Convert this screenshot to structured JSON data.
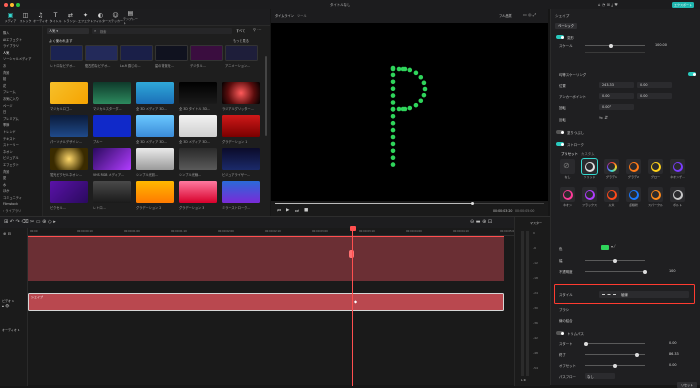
{
  "app": {
    "title": "タイトルなし"
  },
  "titlebar": {
    "export_label": "エクスポート"
  },
  "toolbar": {
    "items": [
      {
        "label": "メディア",
        "glyph": "▣"
      },
      {
        "label": "ストック",
        "glyph": "◫"
      },
      {
        "label": "オーディオ",
        "glyph": "♫"
      },
      {
        "label": "タイトル",
        "glyph": "T"
      },
      {
        "label": "トランジ..",
        "glyph": "⇄"
      },
      {
        "label": "エフェクト",
        "glyph": "✦"
      },
      {
        "label": "フィルター",
        "glyph": "◐"
      },
      {
        "label": "ステッカー",
        "glyph": "☺"
      },
      {
        "label": "テンプレート",
        "glyph": "▤"
      }
    ]
  },
  "sidebar": {
    "items": [
      "購入",
      "AIエフェクト",
      "ライブラリ",
      "人気",
      "ソーシャルメディア",
      "お",
      "背景",
      "桜",
      "花",
      "フレーム",
      "お気に入り",
      "ページ",
      "日",
      "プレミアム",
      "季節",
      "トレンド",
      "テキスト",
      "ストーリー",
      "ネオン",
      "ビジュアル",
      "エフェクト",
      "背景",
      "夏",
      "水",
      "ほか",
      "コミュニティ",
      "Filmstock"
    ],
    "footer": "‹ ライブラリ"
  },
  "media": {
    "tab_label": "人気",
    "search_placeholder": "検索",
    "filter_label": "すべて",
    "section_label": "よく使われます",
    "more_label": "もっと見る",
    "row1_labels": [
      "レトロなビデオ...",
      "復古的なビデオ...",
      "Lo-fi 感じの...",
      "星の背景を...",
      "デジタル...",
      "アニメーション..."
    ],
    "tile_labels": [
      "マジカルロゴ...",
      "マジカルスターダ...",
      "全 3D メディア 3D...",
      "全 3D タイトル 3D...",
      "ラジアルグリッター...",
      "パーソナルデザイン...",
      "ブルー",
      "全 3D メディア 3D...",
      "全 3D メディア 3D...",
      "グラデーション 1",
      "蛍光ピクセルネオン...",
      "VHS RGB メディア...",
      "シンプル光彩...",
      "シンプル光線...",
      "ビジュアライザー...",
      "ピクセル...",
      "レトロ...",
      "グラデーション 2",
      "グラデーション 3",
      "ミラーストローク..."
    ]
  },
  "viewer": {
    "mode_label": "タイムライン",
    "tool_label": "ツール",
    "quality_label": "フル品質",
    "timecode_current": "00:00:03:20",
    "timecode_total": "00:00:05:00",
    "canvas_letter": "P"
  },
  "right_panel": {
    "tab_label": "シェイプ",
    "subtab_label": "ベーシック",
    "sections": {
      "transform": "変形",
      "scale": "スケール",
      "scale_value": "100.00",
      "uniform_scaling": "均等スケーリング",
      "position": "位置",
      "position_x": "243.33",
      "position_y": "0.00",
      "anchor": "アンカーポイント",
      "anchor_x": "0.00",
      "anchor_y": "0.00",
      "rotate": "回転",
      "rotate_value": "0.00°",
      "flip": "反転",
      "fill": "塗りつぶし",
      "stroke": "ストローク",
      "preset_tab": "プリセット",
      "custom_tab": "カスタム",
      "preset_labels": [
        "なし",
        "ソリッド",
        "グラデ1",
        "グラデ2",
        "グロー",
        "ネオンゲ...",
        "ネオン",
        "フラックス",
        "火炎",
        "点線状",
        "スパークル",
        "ボルト"
      ],
      "color_label": "色",
      "width_label": "幅",
      "opacity_label": "不透明度",
      "opacity_value": "100",
      "style_label": "スタイル",
      "style_value": "破線",
      "taper_label": "ブラシ",
      "join_label": "線の結合",
      "trim_label": "トリムパス",
      "trim_start": "スタート",
      "trim_start_value": "0.00",
      "trim_end": "終了",
      "trim_end_value": "86.33",
      "trim_offset": "オフセット",
      "trim_offset_value": "0.00",
      "path_label": "パスフロー",
      "path_value": "なし",
      "reset_label": "リセット"
    }
  },
  "timeline": {
    "ruler_labels": [
      "00:00",
      "00:00:00:10",
      "00:00:01:00",
      "00:00:01:10",
      "00:00:02:00",
      "00:00:02:10",
      "00:00:03:00",
      "00:00:03:10",
      "00:00:04:00",
      "00:00:04:10",
      "00:00:05:00"
    ],
    "master_label": "マスター",
    "track_video_label": "ビデオ 1",
    "track_audio_label": "オーディオ 1",
    "clip_label": "シェイプ",
    "meter_labels": [
      "0",
      "-6",
      "-12",
      "-18",
      "-24",
      "-30",
      "-36",
      "-42",
      "-48",
      "-54"
    ],
    "meter_lr": "L   R"
  },
  "colors": {
    "accent": "#35d9d0",
    "playhead": "#ff4f4f",
    "clip": "#b9484f",
    "highlight": "#ff3b30",
    "stroke_green": "#2fd45b"
  }
}
